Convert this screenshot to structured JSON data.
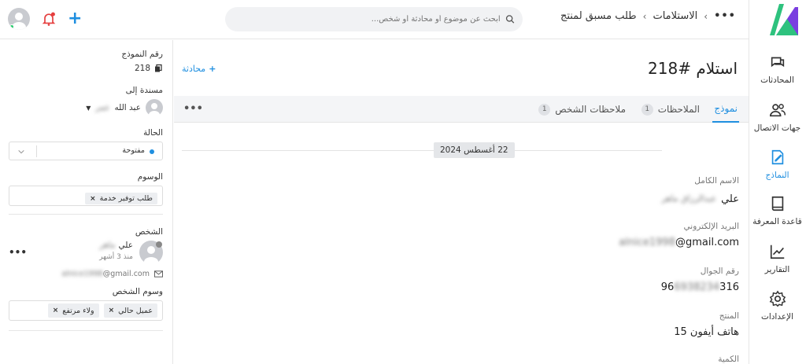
{
  "topbar": {
    "breadcrumb_more": "•••",
    "breadcrumb_root": "الاستلامات",
    "breadcrumb_current": "طلب مسبق لمنتج",
    "search_placeholder": "ابحث عن موضوع أو محادثة أو شخص..."
  },
  "nav": {
    "items": [
      {
        "label": "المحادثات",
        "icon": "chat-icon"
      },
      {
        "label": "جهات الاتصال",
        "icon": "contacts-icon"
      },
      {
        "label": "النماذج",
        "icon": "forms-icon"
      },
      {
        "label": "قاعدة المعرفة",
        "icon": "book-icon"
      },
      {
        "label": "التقارير",
        "icon": "chart-icon"
      },
      {
        "label": "الإعدادات",
        "icon": "gear-icon"
      }
    ],
    "active": "النماذج",
    "accent": "#1f8fe0"
  },
  "left": {
    "form_number_label": "رقم النموذج",
    "form_number": "218",
    "assigned_label": "مسندة إلى",
    "assignee_first": "عبد الله",
    "assignee_blur": "عمر",
    "status_label": "الحالة",
    "status_value": "مفتوحة",
    "tags_label": "الوسوم",
    "tag": "طلب توفير خدمة",
    "person_label": "الشخص",
    "person_first": "علي",
    "person_blur": "ماهر",
    "person_since": "منذ 3 أشهر",
    "email_blur": "alnice1998",
    "email_domain": "@gmail.com",
    "person_tags_label": "وسوم الشخص",
    "person_tags": [
      "عميل حالي",
      "ولاء مرتفع"
    ]
  },
  "main": {
    "title": "استلام #218",
    "add_conversation": "محادثة",
    "tabs": [
      {
        "label": "نموذج",
        "count": ""
      },
      {
        "label": "الملاحظات",
        "count": "1"
      },
      {
        "label": "ملاحظات الشخص",
        "count": "1"
      }
    ],
    "tabs_more": "•••",
    "date": "22 أغسطس 2024",
    "fields": [
      {
        "label": "الاسم الكامل",
        "value_main": "علي",
        "value_blur": "عبدالرزاق ماهر"
      },
      {
        "label": "البريد الإلكتروني",
        "value_blur": "alnice1998",
        "value_main": "@gmail.com"
      },
      {
        "label": "رقم الجوال",
        "value_start": "96",
        "value_blur": "6938234",
        "value_end": "316"
      },
      {
        "label": "المنتج",
        "value_main": "هاتف أيفون 15"
      },
      {
        "label": "الكمية"
      }
    ]
  }
}
